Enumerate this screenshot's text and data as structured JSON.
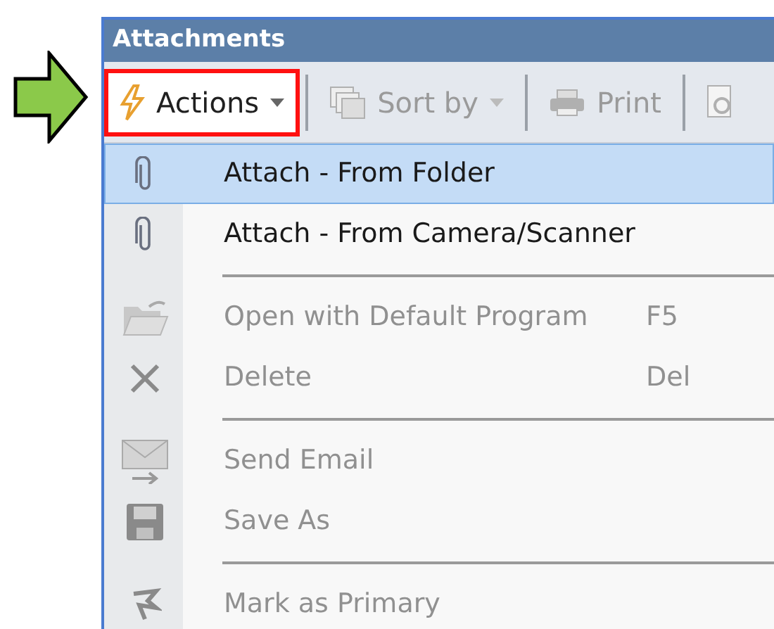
{
  "panel": {
    "title": "Attachments"
  },
  "toolbar": [
    {
      "kind": "actions",
      "label": "Actions",
      "disabled": false,
      "highlighted": true,
      "dropdown": true
    },
    {
      "kind": "sort",
      "label": "Sort by",
      "disabled": true,
      "highlighted": false,
      "dropdown": true
    },
    {
      "kind": "print",
      "label": "Print",
      "disabled": true,
      "highlighted": false,
      "dropdown": false
    },
    {
      "kind": "preview",
      "disabled": true,
      "highlighted": false,
      "dropdown": false
    }
  ],
  "menu": [
    {
      "kind": "attach",
      "label": "Attach - From Folder",
      "selected": true,
      "disabled": false
    },
    {
      "kind": "attach",
      "label": "Attach - From Camera/Scanner",
      "selected": false,
      "disabled": false
    },
    {
      "kind": "separator"
    },
    {
      "kind": "open",
      "label": "Open with Default Program",
      "shortcut": "F5",
      "selected": false,
      "disabled": true
    },
    {
      "kind": "delete",
      "label": "Delete",
      "shortcut": "Del",
      "selected": false,
      "disabled": true
    },
    {
      "kind": "separator"
    },
    {
      "kind": "email",
      "label": "Send Email",
      "selected": false,
      "disabled": true
    },
    {
      "kind": "save",
      "label": "Save As",
      "selected": false,
      "disabled": true
    },
    {
      "kind": "separator"
    },
    {
      "kind": "primary",
      "label": "Mark as Primary",
      "selected": false,
      "disabled": true
    }
  ]
}
